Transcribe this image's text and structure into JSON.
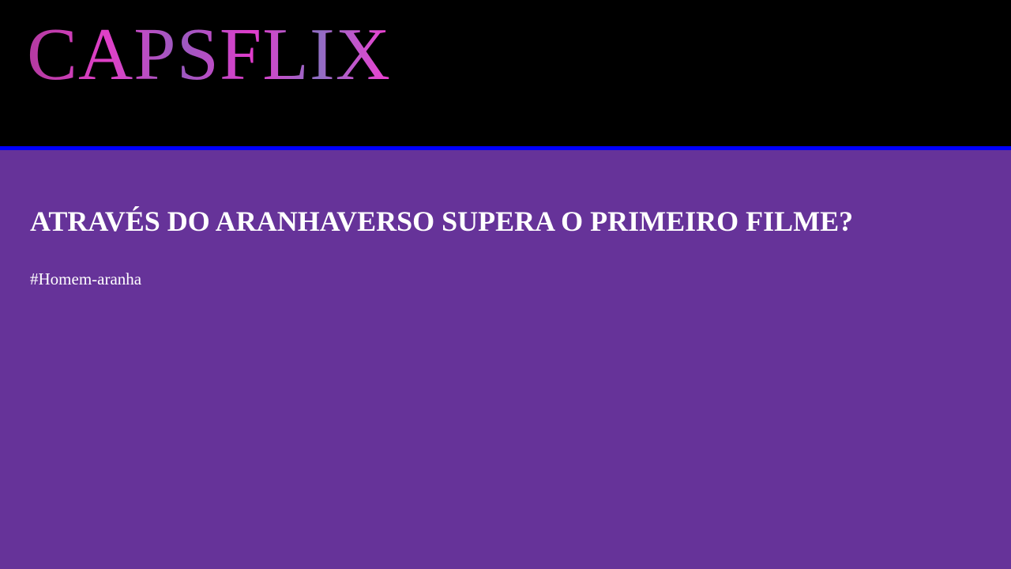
{
  "header": {
    "logo_text": "CAPSFLIX"
  },
  "post": {
    "title": "ATRAVÉS DO ARANHAVERSO SUPERA O PRIMEIRO FILME?",
    "tag": "#Homem-aranha"
  },
  "colors": {
    "page_background": "#663399",
    "header_background": "#000000",
    "header_border": "#0000ff",
    "text": "#ffffff",
    "logo_gradient": [
      "#b23aa0",
      "#e040c8",
      "#9a5abf",
      "#e13ccc",
      "#8f6fc4",
      "#f03fd2"
    ]
  }
}
